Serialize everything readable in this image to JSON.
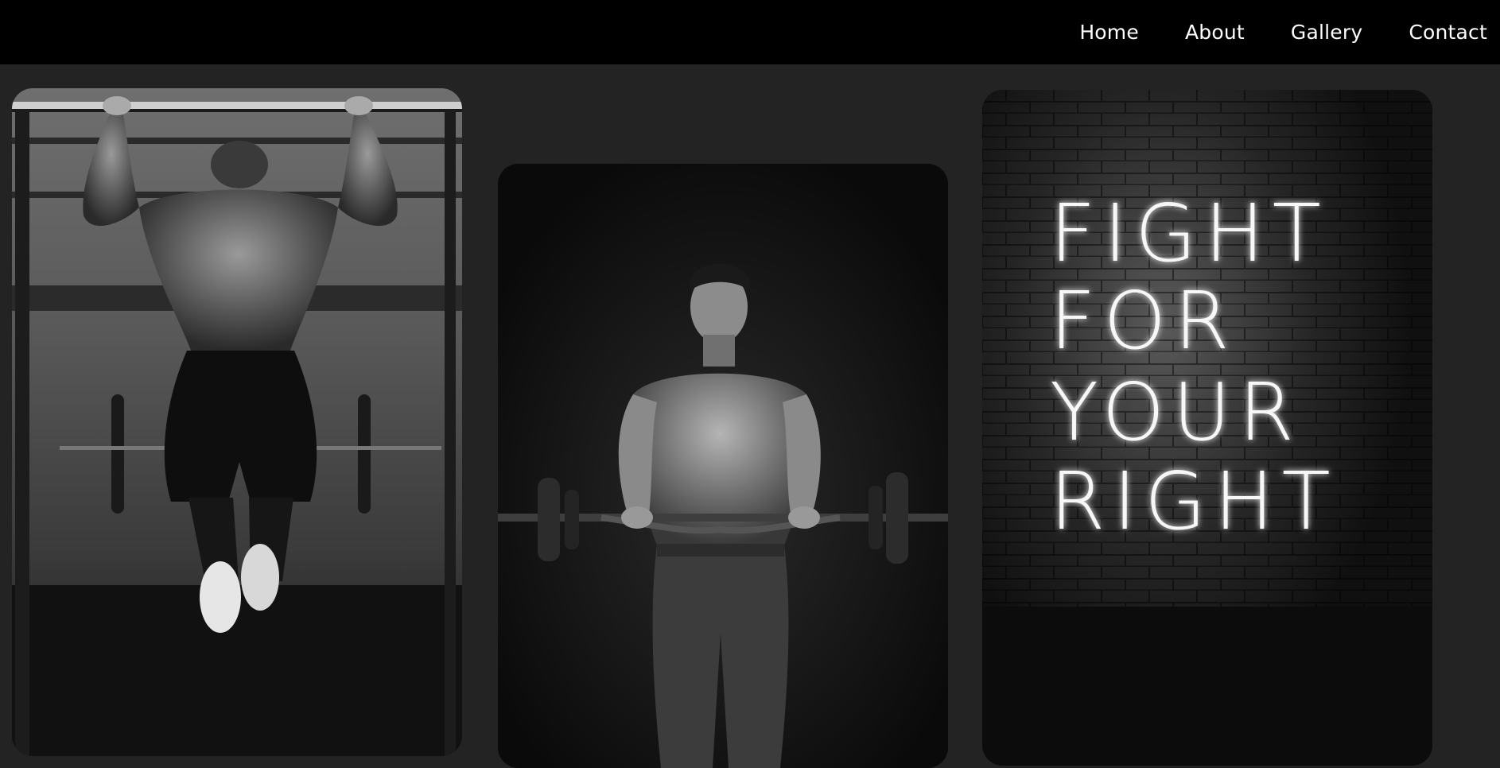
{
  "nav": {
    "items": [
      {
        "label": "Home"
      },
      {
        "label": "About"
      },
      {
        "label": "Gallery"
      },
      {
        "label": "Contact"
      }
    ]
  },
  "gallery": {
    "cards": [
      {
        "subject": "man doing pull-ups on a bar, back view, black and white photo"
      },
      {
        "subject": "muscular man holding a barbell, black and white photo"
      },
      {
        "subject": "neon sign on brick wall"
      }
    ],
    "neon_sign": {
      "lines": [
        "FIGHT",
        "FOR",
        "YOUR",
        "RIGHT"
      ]
    }
  },
  "colors": {
    "nav_background": "#000000",
    "page_background": "#232323",
    "nav_text": "#ffffff"
  }
}
